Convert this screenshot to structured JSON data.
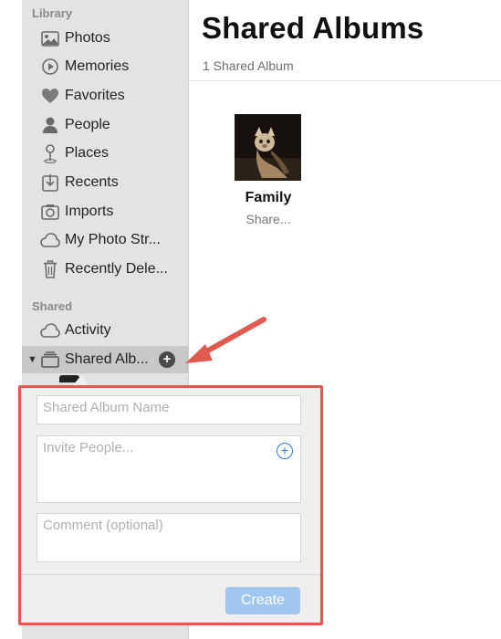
{
  "sidebar": {
    "library_header": "Library",
    "library_items": [
      {
        "label": "Photos",
        "icon": "photos-icon"
      },
      {
        "label": "Memories",
        "icon": "memories-icon"
      },
      {
        "label": "Favorites",
        "icon": "heart-icon"
      },
      {
        "label": "People",
        "icon": "person-icon"
      },
      {
        "label": "Places",
        "icon": "pin-icon"
      },
      {
        "label": "Recents",
        "icon": "recents-icon"
      },
      {
        "label": "Imports",
        "icon": "camera-icon"
      },
      {
        "label": "My Photo Str...",
        "icon": "cloud-icon"
      },
      {
        "label": "Recently Dele...",
        "icon": "trash-icon"
      }
    ],
    "shared_header": "Shared",
    "activity_label": "Activity",
    "shared_albums_label": "Shared Alb...",
    "add_symbol": "+"
  },
  "main": {
    "title": "Shared Albums",
    "count": "1 Shared Album",
    "album": {
      "name": "Family",
      "subtitle": "Share..."
    }
  },
  "popover": {
    "name_placeholder": "Shared Album Name",
    "invite_placeholder": "Invite People...",
    "comment_placeholder": "Comment (optional)",
    "create_label": "Create",
    "invite_add_symbol": "+"
  },
  "colors": {
    "annotation": "#e05a4f",
    "accent": "#2f7ad6",
    "create_disabled": "#9fc7f0"
  }
}
